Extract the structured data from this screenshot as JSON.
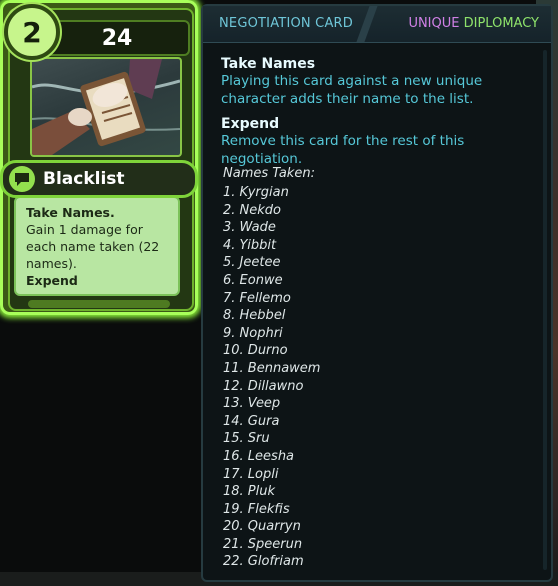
{
  "card": {
    "cost": "2",
    "resolve": "24",
    "name": "Blacklist",
    "desc_keyword": "Take Names.",
    "desc_text": "Gain 1 damage for each name taken (22 names).",
    "desc_keyword2": "Expend",
    "type_icon": "speech-bubble-icon",
    "accent": "#8cf23a"
  },
  "tooltip": {
    "header_left": "NEGOTIATION CARD",
    "header_unique": "UNIQUE",
    "header_type": "DIPLOMACY",
    "sections": [
      {
        "title": "Take Names",
        "body": "Playing this card against a new unique character adds their name to the list."
      },
      {
        "title": "Expend",
        "body": "Remove this card for the rest of this negotiation."
      }
    ],
    "names_heading": "Names Taken:",
    "names": [
      "1. Kyrgian",
      "2. Nekdo",
      "3. Wade",
      "4. Yibbit",
      "5. Jeetee",
      "6. Eonwe",
      "7. Fellemo",
      "8. Hebbel",
      "9. Nophri",
      "10. Durno",
      "11. Bennawem",
      "12. Dillawno",
      "13. Veep",
      "14. Gura",
      "15. Sru",
      "16. Leesha",
      "17. Lopli",
      "18. Pluk",
      "19. Flekfis",
      "20. Quarryn",
      "21. Speerun",
      "22. Glofriam"
    ]
  },
  "colors": {
    "uniq": "#d080e6",
    "diplomacy": "#8ee36b",
    "body_text": "#56c8d8"
  }
}
